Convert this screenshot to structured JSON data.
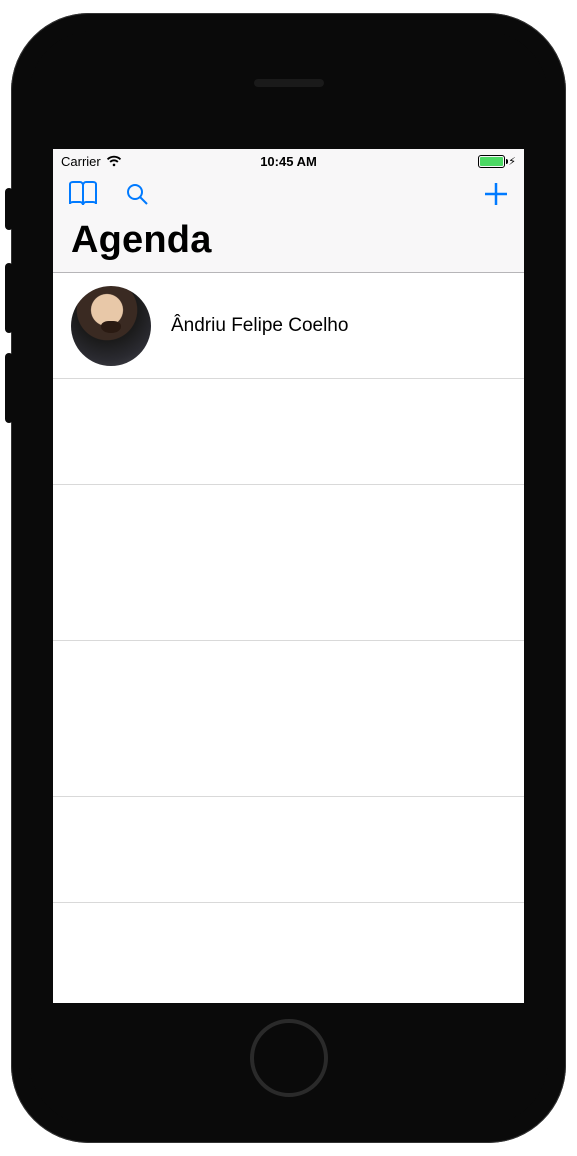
{
  "status_bar": {
    "carrier": "Carrier",
    "time": "10:45 AM"
  },
  "nav": {
    "title": "Agenda"
  },
  "contacts": [
    {
      "name": "Ândriu Felipe Coelho"
    }
  ],
  "colors": {
    "tint": "#007aff",
    "battery_fill": "#4cd964"
  }
}
